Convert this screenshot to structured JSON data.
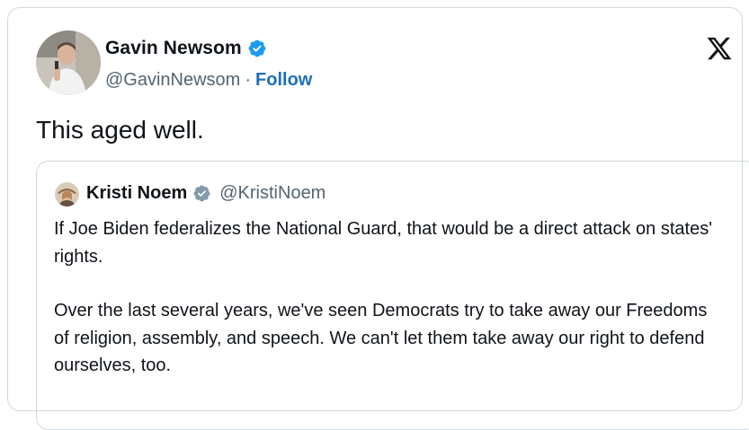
{
  "tweet": {
    "author_name": "Gavin Newsom",
    "author_handle": "@GavinNewsom",
    "separator": "·",
    "follow_label": "Follow",
    "text": "This aged well."
  },
  "quoted_tweet": {
    "author_name": "Kristi Noem",
    "author_handle": "@KristiNoem",
    "paragraphs": [
      "If Joe Biden federalizes the National Guard, that would be a direct attack on states' rights.",
      "Over the last several years, we've seen Democrats try to take away our Freedoms of religion, assembly, and speech. We can't let them take away our right to defend ourselves, too."
    ]
  },
  "icons": {
    "verified": "verified-badge-icon",
    "logo": "x-logo-icon"
  },
  "colors": {
    "verified_blue": "#1d9bf0",
    "verified_gray": "#829aab",
    "follow_link": "#1d6fb8",
    "secondary_text": "#536471",
    "border": "#cfd9de"
  }
}
